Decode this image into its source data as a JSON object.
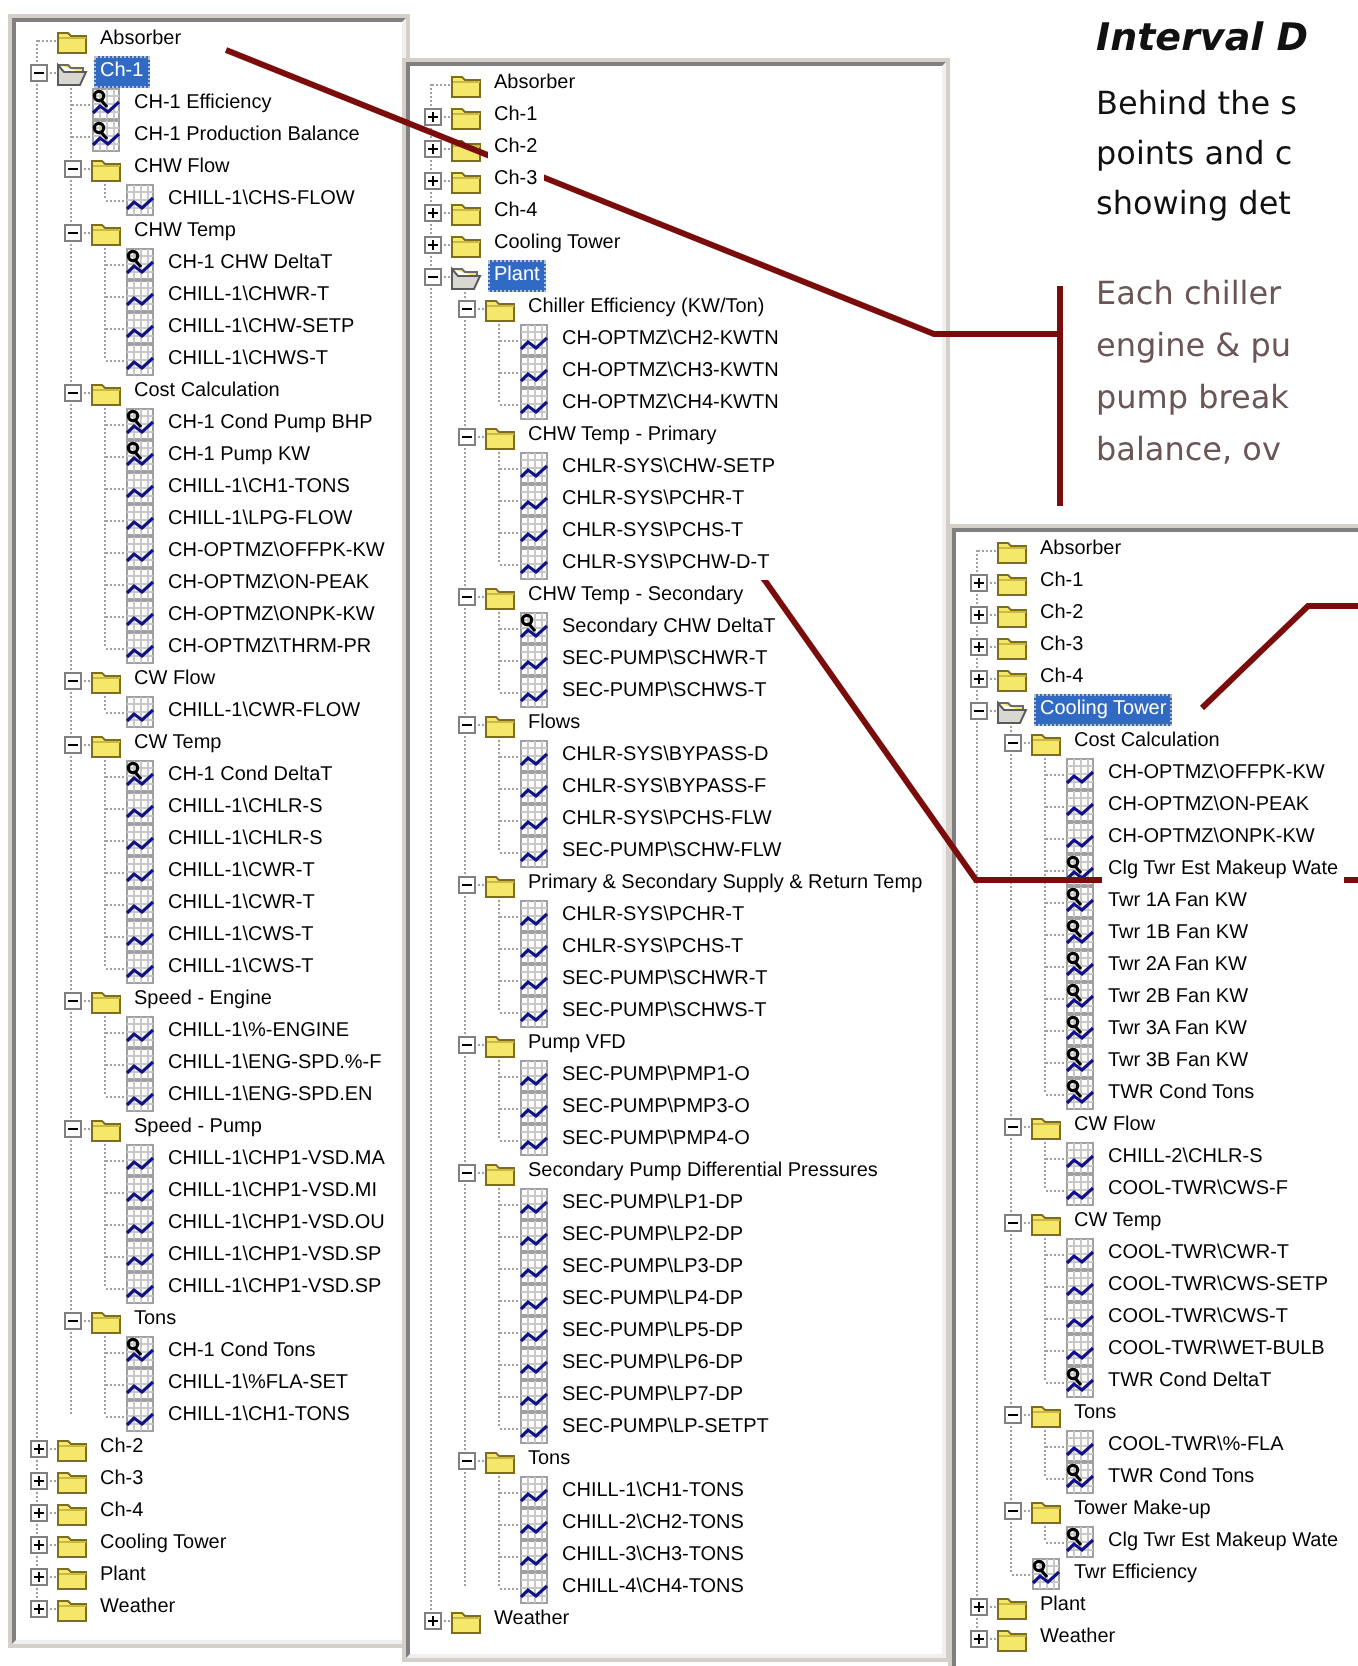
{
  "panels": [
    {
      "items": [
        {
          "label": "Absorber",
          "kind": "folder",
          "selected": false
        },
        {
          "label": "Ch-1",
          "kind": "folder",
          "expanded": true,
          "selected": true,
          "children": [
            {
              "label": "CH-1 Efficiency",
              "kind": "calc",
              "selected": false
            },
            {
              "label": "CH-1 Production Balance",
              "kind": "calc",
              "selected": false
            },
            {
              "label": "CHW Flow",
              "kind": "folder",
              "expanded": true,
              "selected": false,
              "children": [
                {
                  "label": "CHILL-1\\CHS-FLOW",
                  "kind": "trend",
                  "selected": false
                }
              ]
            },
            {
              "label": "CHW Temp",
              "kind": "folder",
              "expanded": true,
              "selected": false,
              "children": [
                {
                  "label": "CH-1 CHW DeltaT",
                  "kind": "calc",
                  "selected": false
                },
                {
                  "label": "CHILL-1\\CHWR-T",
                  "kind": "trend",
                  "selected": false
                },
                {
                  "label": "CHILL-1\\CHW-SETP",
                  "kind": "trend",
                  "selected": false
                },
                {
                  "label": "CHILL-1\\CHWS-T",
                  "kind": "trend",
                  "selected": false
                }
              ]
            },
            {
              "label": "Cost Calculation",
              "kind": "folder",
              "expanded": true,
              "selected": false,
              "children": [
                {
                  "label": "CH-1 Cond Pump BHP",
                  "kind": "calc",
                  "selected": false
                },
                {
                  "label": "CH-1 Pump KW",
                  "kind": "calc",
                  "selected": false
                },
                {
                  "label": "CHILL-1\\CH1-TONS",
                  "kind": "trend",
                  "selected": false
                },
                {
                  "label": "CHILL-1\\LPG-FLOW",
                  "kind": "trend",
                  "selected": false
                },
                {
                  "label": "CH-OPTMZ\\OFFPK-KW",
                  "kind": "trend",
                  "selected": false
                },
                {
                  "label": "CH-OPTMZ\\ON-PEAK",
                  "kind": "trend",
                  "selected": false
                },
                {
                  "label": "CH-OPTMZ\\ONPK-KW",
                  "kind": "trend",
                  "selected": false
                },
                {
                  "label": "CH-OPTMZ\\THRM-PR",
                  "kind": "trend",
                  "selected": false
                }
              ]
            },
            {
              "label": "CW Flow",
              "kind": "folder",
              "expanded": true,
              "selected": false,
              "children": [
                {
                  "label": "CHILL-1\\CWR-FLOW",
                  "kind": "trend",
                  "selected": false
                }
              ]
            },
            {
              "label": "CW Temp",
              "kind": "folder",
              "expanded": true,
              "selected": false,
              "children": [
                {
                  "label": "CH-1 Cond DeltaT",
                  "kind": "calc",
                  "selected": false
                },
                {
                  "label": "CHILL-1\\CHLR-S",
                  "kind": "trend",
                  "selected": false
                },
                {
                  "label": "CHILL-1\\CHLR-S",
                  "kind": "trend",
                  "selected": false
                },
                {
                  "label": "CHILL-1\\CWR-T",
                  "kind": "trend",
                  "selected": false
                },
                {
                  "label": "CHILL-1\\CWR-T",
                  "kind": "trend",
                  "selected": false
                },
                {
                  "label": "CHILL-1\\CWS-T",
                  "kind": "trend",
                  "selected": false
                },
                {
                  "label": "CHILL-1\\CWS-T",
                  "kind": "trend",
                  "selected": false
                }
              ]
            },
            {
              "label": "Speed - Engine",
              "kind": "folder",
              "expanded": true,
              "selected": false,
              "children": [
                {
                  "label": "CHILL-1\\%-ENGINE",
                  "kind": "trend",
                  "selected": false
                },
                {
                  "label": "CHILL-1\\ENG-SPD.%-F",
                  "kind": "trend",
                  "selected": false
                },
                {
                  "label": "CHILL-1\\ENG-SPD.EN",
                  "kind": "trend",
                  "selected": false
                }
              ]
            },
            {
              "label": "Speed - Pump",
              "kind": "folder",
              "expanded": true,
              "selected": false,
              "children": [
                {
                  "label": "CHILL-1\\CHP1-VSD.MA",
                  "kind": "trend",
                  "selected": false
                },
                {
                  "label": "CHILL-1\\CHP1-VSD.MI",
                  "kind": "trend",
                  "selected": false
                },
                {
                  "label": "CHILL-1\\CHP1-VSD.OU",
                  "kind": "trend",
                  "selected": false
                },
                {
                  "label": "CHILL-1\\CHP1-VSD.SP",
                  "kind": "trend",
                  "selected": false
                },
                {
                  "label": "CHILL-1\\CHP1-VSD.SP",
                  "kind": "trend",
                  "selected": false
                }
              ]
            },
            {
              "label": "Tons",
              "kind": "folder",
              "expanded": true,
              "selected": false,
              "children": [
                {
                  "label": "CH-1 Cond Tons",
                  "kind": "calc",
                  "selected": false
                },
                {
                  "label": "CHILL-1\\%FLA-SET",
                  "kind": "trend",
                  "selected": false
                },
                {
                  "label": "CHILL-1\\CH1-TONS",
                  "kind": "trend",
                  "selected": false
                }
              ]
            }
          ]
        },
        {
          "label": "Ch-2",
          "kind": "folder",
          "expanded": false,
          "selected": false
        },
        {
          "label": "Ch-3",
          "kind": "folder",
          "expanded": false,
          "selected": false
        },
        {
          "label": "Ch-4",
          "kind": "folder",
          "expanded": false,
          "selected": false
        },
        {
          "label": "Cooling Tower",
          "kind": "folder",
          "expanded": false,
          "selected": false
        },
        {
          "label": "Plant",
          "kind": "folder",
          "expanded": false,
          "selected": false
        },
        {
          "label": "Weather",
          "kind": "folder",
          "expanded": false,
          "selected": false
        }
      ]
    },
    {
      "items": [
        {
          "label": "Absorber",
          "kind": "folder",
          "selected": false
        },
        {
          "label": "Ch-1",
          "kind": "folder",
          "expanded": false,
          "selected": false
        },
        {
          "label": "Ch-2",
          "kind": "folder",
          "expanded": false,
          "selected": false
        },
        {
          "label": "Ch-3",
          "kind": "folder",
          "expanded": false,
          "selected": false
        },
        {
          "label": "Ch-4",
          "kind": "folder",
          "expanded": false,
          "selected": false
        },
        {
          "label": "Cooling Tower",
          "kind": "folder",
          "expanded": false,
          "selected": false
        },
        {
          "label": "Plant",
          "kind": "folder",
          "expanded": true,
          "selected": true,
          "children": [
            {
              "label": "Chiller Efficiency (KW/Ton)",
              "kind": "folder",
              "expanded": true,
              "selected": false,
              "children": [
                {
                  "label": "CH-OPTMZ\\CH2-KWTN",
                  "kind": "trend",
                  "selected": false
                },
                {
                  "label": "CH-OPTMZ\\CH3-KWTN",
                  "kind": "trend",
                  "selected": false
                },
                {
                  "label": "CH-OPTMZ\\CH4-KWTN",
                  "kind": "trend",
                  "selected": false
                }
              ]
            },
            {
              "label": "CHW Temp - Primary",
              "kind": "folder",
              "expanded": true,
              "selected": false,
              "children": [
                {
                  "label": "CHLR-SYS\\CHW-SETP",
                  "kind": "trend",
                  "selected": false
                },
                {
                  "label": "CHLR-SYS\\PCHR-T",
                  "kind": "trend",
                  "selected": false
                },
                {
                  "label": "CHLR-SYS\\PCHS-T",
                  "kind": "trend",
                  "selected": false
                },
                {
                  "label": "CHLR-SYS\\PCHW-D-T",
                  "kind": "trend",
                  "selected": false
                }
              ]
            },
            {
              "label": "CHW Temp - Secondary",
              "kind": "folder",
              "expanded": true,
              "selected": false,
              "children": [
                {
                  "label": "Secondary CHW DeltaT",
                  "kind": "calc",
                  "selected": false
                },
                {
                  "label": "SEC-PUMP\\SCHWR-T",
                  "kind": "trend",
                  "selected": false
                },
                {
                  "label": "SEC-PUMP\\SCHWS-T",
                  "kind": "trend",
                  "selected": false
                }
              ]
            },
            {
              "label": "Flows",
              "kind": "folder",
              "expanded": true,
              "selected": false,
              "children": [
                {
                  "label": "CHLR-SYS\\BYPASS-D",
                  "kind": "trend",
                  "selected": false
                },
                {
                  "label": "CHLR-SYS\\BYPASS-F",
                  "kind": "trend",
                  "selected": false
                },
                {
                  "label": "CHLR-SYS\\PCHS-FLW",
                  "kind": "trend",
                  "selected": false
                },
                {
                  "label": "SEC-PUMP\\SCHW-FLW",
                  "kind": "trend",
                  "selected": false
                }
              ]
            },
            {
              "label": "Primary & Secondary Supply & Return Temp",
              "kind": "folder",
              "expanded": true,
              "selected": false,
              "children": [
                {
                  "label": "CHLR-SYS\\PCHR-T",
                  "kind": "trend",
                  "selected": false
                },
                {
                  "label": "CHLR-SYS\\PCHS-T",
                  "kind": "trend",
                  "selected": false
                },
                {
                  "label": "SEC-PUMP\\SCHWR-T",
                  "kind": "trend",
                  "selected": false
                },
                {
                  "label": "SEC-PUMP\\SCHWS-T",
                  "kind": "trend",
                  "selected": false
                }
              ]
            },
            {
              "label": "Pump VFD",
              "kind": "folder",
              "expanded": true,
              "selected": false,
              "children": [
                {
                  "label": "SEC-PUMP\\PMP1-O",
                  "kind": "trend",
                  "selected": false
                },
                {
                  "label": "SEC-PUMP\\PMP3-O",
                  "kind": "trend",
                  "selected": false
                },
                {
                  "label": "SEC-PUMP\\PMP4-O",
                  "kind": "trend",
                  "selected": false
                }
              ]
            },
            {
              "label": "Secondary Pump Differential Pressures",
              "kind": "folder",
              "expanded": true,
              "selected": false,
              "children": [
                {
                  "label": "SEC-PUMP\\LP1-DP",
                  "kind": "trend",
                  "selected": false
                },
                {
                  "label": "SEC-PUMP\\LP2-DP",
                  "kind": "trend",
                  "selected": false
                },
                {
                  "label": "SEC-PUMP\\LP3-DP",
                  "kind": "trend",
                  "selected": false
                },
                {
                  "label": "SEC-PUMP\\LP4-DP",
                  "kind": "trend",
                  "selected": false
                },
                {
                  "label": "SEC-PUMP\\LP5-DP",
                  "kind": "trend",
                  "selected": false
                },
                {
                  "label": "SEC-PUMP\\LP6-DP",
                  "kind": "trend",
                  "selected": false
                },
                {
                  "label": "SEC-PUMP\\LP7-DP",
                  "kind": "trend",
                  "selected": false
                },
                {
                  "label": "SEC-PUMP\\LP-SETPT",
                  "kind": "trend",
                  "selected": false
                }
              ]
            },
            {
              "label": "Tons",
              "kind": "folder",
              "expanded": true,
              "selected": false,
              "children": [
                {
                  "label": "CHILL-1\\CH1-TONS",
                  "kind": "trend",
                  "selected": false
                },
                {
                  "label": "CHILL-2\\CH2-TONS",
                  "kind": "trend",
                  "selected": false
                },
                {
                  "label": "CHILL-3\\CH3-TONS",
                  "kind": "trend",
                  "selected": false
                },
                {
                  "label": "CHILL-4\\CH4-TONS",
                  "kind": "trend",
                  "selected": false
                }
              ]
            }
          ]
        },
        {
          "label": "Weather",
          "kind": "folder",
          "expanded": false,
          "selected": false
        }
      ]
    },
    {
      "items": [
        {
          "label": "Absorber",
          "kind": "folder",
          "selected": false
        },
        {
          "label": "Ch-1",
          "kind": "folder",
          "expanded": false,
          "selected": false
        },
        {
          "label": "Ch-2",
          "kind": "folder",
          "expanded": false,
          "selected": false
        },
        {
          "label": "Ch-3",
          "kind": "folder",
          "expanded": false,
          "selected": false
        },
        {
          "label": "Ch-4",
          "kind": "folder",
          "expanded": false,
          "selected": false
        },
        {
          "label": "Cooling Tower",
          "kind": "folder",
          "expanded": true,
          "selected": true,
          "children": [
            {
              "label": "Cost Calculation",
              "kind": "folder",
              "expanded": true,
              "selected": false,
              "children": [
                {
                  "label": "CH-OPTMZ\\OFFPK-KW",
                  "kind": "trend",
                  "selected": false
                },
                {
                  "label": "CH-OPTMZ\\ON-PEAK",
                  "kind": "trend",
                  "selected": false
                },
                {
                  "label": "CH-OPTMZ\\ONPK-KW",
                  "kind": "trend",
                  "selected": false
                },
                {
                  "label": "Clg Twr Est Makeup Wate",
                  "kind": "calc",
                  "selected": false
                },
                {
                  "label": "Twr 1A Fan KW",
                  "kind": "calc",
                  "selected": false
                },
                {
                  "label": "Twr 1B Fan KW",
                  "kind": "calc",
                  "selected": false
                },
                {
                  "label": "Twr 2A Fan KW",
                  "kind": "calc",
                  "selected": false
                },
                {
                  "label": "Twr 2B Fan KW",
                  "kind": "calc",
                  "selected": false
                },
                {
                  "label": "Twr 3A Fan KW",
                  "kind": "calc",
                  "selected": false
                },
                {
                  "label": "Twr 3B Fan KW",
                  "kind": "calc",
                  "selected": false
                },
                {
                  "label": "TWR Cond Tons",
                  "kind": "calc",
                  "selected": false
                }
              ]
            },
            {
              "label": "CW Flow",
              "kind": "folder",
              "expanded": true,
              "selected": false,
              "children": [
                {
                  "label": "CHILL-2\\CHLR-S",
                  "kind": "trend",
                  "selected": false
                },
                {
                  "label": "COOL-TWR\\CWS-F",
                  "kind": "trend",
                  "selected": false
                }
              ]
            },
            {
              "label": "CW Temp",
              "kind": "folder",
              "expanded": true,
              "selected": false,
              "children": [
                {
                  "label": "COOL-TWR\\CWR-T",
                  "kind": "trend",
                  "selected": false
                },
                {
                  "label": "COOL-TWR\\CWS-SETP",
                  "kind": "trend",
                  "selected": false
                },
                {
                  "label": "COOL-TWR\\CWS-T",
                  "kind": "trend",
                  "selected": false
                },
                {
                  "label": "COOL-TWR\\WET-BULB",
                  "kind": "trend",
                  "selected": false
                },
                {
                  "label": "TWR Cond DeltaT",
                  "kind": "calc",
                  "selected": false
                }
              ]
            },
            {
              "label": "Tons",
              "kind": "folder",
              "expanded": true,
              "selected": false,
              "children": [
                {
                  "label": "COOL-TWR\\%-FLA",
                  "kind": "trend",
                  "selected": false
                },
                {
                  "label": "TWR Cond Tons",
                  "kind": "calc",
                  "selected": false
                }
              ]
            },
            {
              "label": "Tower Make-up",
              "kind": "folder",
              "expanded": true,
              "selected": false,
              "children": [
                {
                  "label": "Clg Twr Est Makeup Wate",
                  "kind": "calc",
                  "selected": false
                }
              ]
            },
            {
              "label": "Twr Efficiency",
              "kind": "calc",
              "selected": false
            }
          ]
        },
        {
          "label": "Plant",
          "kind": "folder",
          "expanded": false,
          "selected": false
        },
        {
          "label": "Weather",
          "kind": "folder",
          "expanded": false,
          "selected": false
        }
      ]
    }
  ],
  "heading": "Interval D",
  "intro_lines": [
    "Behind the s",
    "points and c",
    "showing det"
  ],
  "note_lines": [
    "Each chiller",
    "engine & pu",
    "pump break",
    "balance, ov"
  ]
}
